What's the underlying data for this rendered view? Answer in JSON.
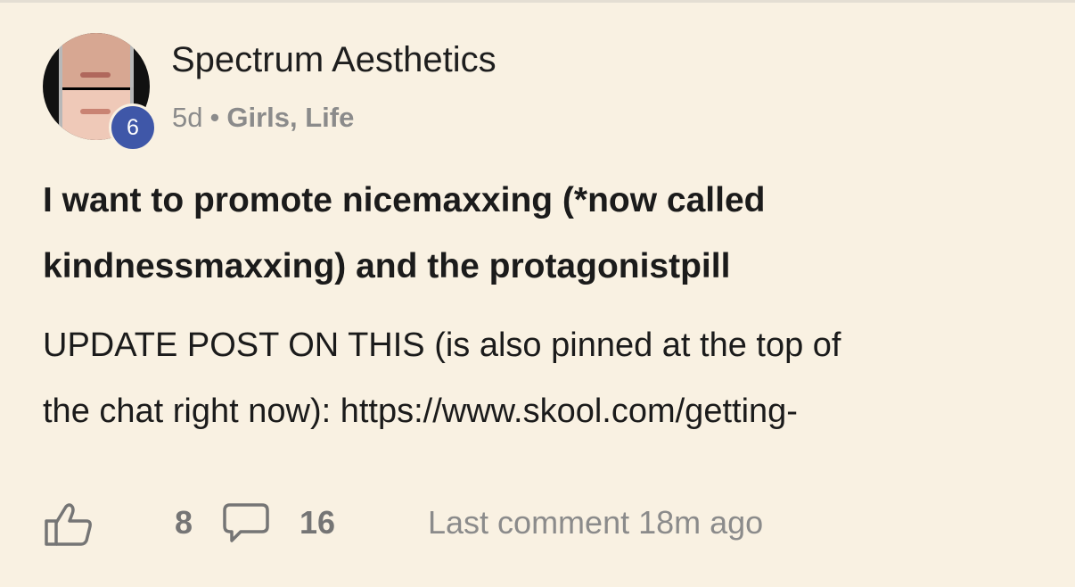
{
  "post": {
    "author": "Spectrum Aesthetics",
    "level": "6",
    "time_ago": "5d",
    "separator": "•",
    "categories": "Girls, Life",
    "title_line1": "I want to promote nicemaxxing (*now called",
    "title_line2": "kindnessmaxxing) and the protagonistpill",
    "body_line1": "UPDATE POST ON THIS (is also pinned at the top of",
    "body_line2": "the chat right now): https://www.skool.com/getting-",
    "likes": "8",
    "comments": "16",
    "last_comment": "Last comment 18m ago"
  },
  "icons": {
    "like": "thumbs-up-icon",
    "comment": "comment-bubble-icon"
  },
  "colors": {
    "background": "#f9f1e2",
    "badge": "#3f57a8",
    "muted_text": "#8b8b8b"
  }
}
